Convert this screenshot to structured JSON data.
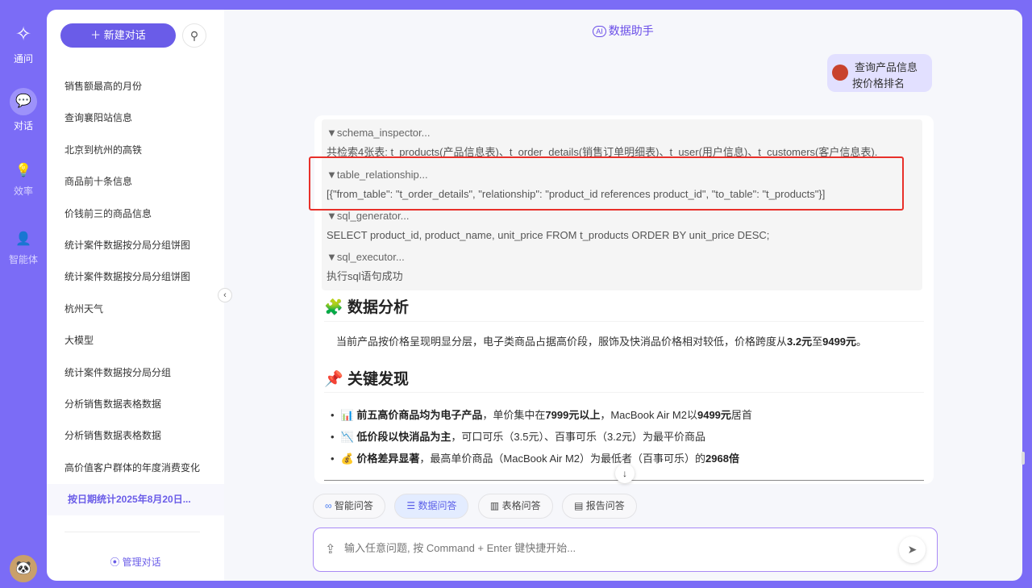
{
  "rail": {
    "items": [
      {
        "label": "通问",
        "icon": "logo-icon"
      },
      {
        "label": "对话",
        "icon": "chat-icon"
      },
      {
        "label": "效率",
        "icon": "bulb-icon"
      },
      {
        "label": "智能体",
        "icon": "agent-icon"
      }
    ]
  },
  "sidebar": {
    "new_chat": "新建对话",
    "history": [
      "销售额最高的月份",
      "查询襄阳站信息",
      "北京到杭州的高铁",
      "商品前十条信息",
      "价钱前三的商品信息",
      "统计案件数据按分局分组饼图",
      "统计案件数据按分局分组饼图",
      "杭州天气",
      "大模型",
      "统计案件数据按分局分组",
      "分析销售数据表格数据",
      "分析销售数据表格数据",
      "高价值客户群体的年度消费变化",
      "按日期统计2025年8月20日..."
    ],
    "manage": "管理对话"
  },
  "header": {
    "ai": "AI",
    "title": "数据助手"
  },
  "user_msg": {
    "line1": "查询产品信息",
    "line2": "按价格排名"
  },
  "tools": [
    {
      "name": "▼schema_inspector...",
      "output": "共检索4张表: t_products(产品信息表)、t_order_details(销售订单明细表)、t_user(用户信息)、t_customers(客户信息表)."
    },
    {
      "name": "▼table_relationship...",
      "output": "[{\"from_table\": \"t_order_details\", \"relationship\": \"product_id references product_id\", \"to_table\": \"t_products\"}]"
    },
    {
      "name": "▼sql_generator...",
      "output": "SELECT product_id, product_name, unit_price FROM t_products ORDER BY unit_price DESC;"
    },
    {
      "name": "▼sql_executor...",
      "output": "执行sql语句成功"
    }
  ],
  "analysis": {
    "icon": "🧩",
    "heading": "数据分析",
    "p1": "当前产品按价格呈现明显分层，电子类商品占据高价段，服饰及快消品价格相对较低，价格跨度从",
    "p_b1": "3.2元",
    "p2": "至",
    "p_b2": "9499元",
    "p3": "。"
  },
  "findings": {
    "icon": "📌",
    "heading": "关键发现",
    "items": [
      {
        "icon": "📊",
        "b1": "前五高价商品均为电子产品",
        "t1": "，单价集中在",
        "b2": "7999元以上",
        "t2": "，MacBook Air M2以",
        "b3": "9499元",
        "t3": "居首"
      },
      {
        "icon": "📉",
        "b1": "低价段以快消品为主",
        "t1": "，可口可乐（3.5元）、百事可乐（3.2元）为最平价商品",
        "b2": "",
        "t2": "",
        "b3": "",
        "t3": ""
      },
      {
        "icon": "💰",
        "b1": "价格差异显著",
        "t1": "，最高单价商品（MacBook Air M2）为最低者（百事可乐）的",
        "b2": "2968倍",
        "t2": "",
        "b3": "",
        "t3": ""
      }
    ]
  },
  "modes": [
    "智能问答",
    "数据问答",
    "表格问答",
    "报告问答"
  ],
  "input": {
    "placeholder": "输入任意问题, 按 Command + Enter 键快捷开始..."
  }
}
